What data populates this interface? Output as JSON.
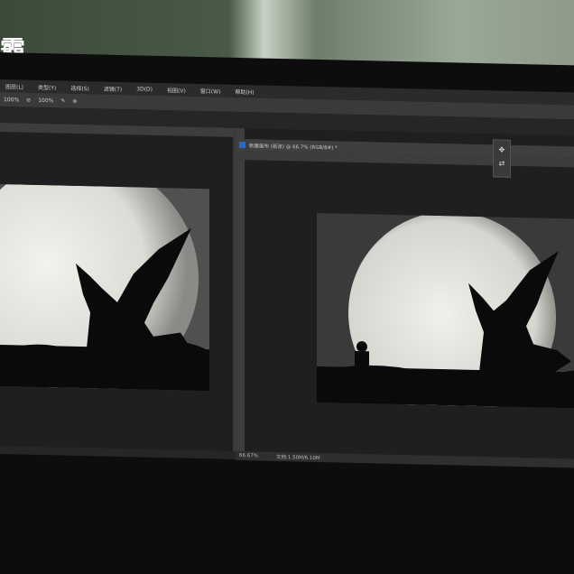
{
  "watermark": {
    "text": "霸"
  },
  "menu": {
    "items": [
      "图层(L)",
      "类型(Y)",
      "选择(S)",
      "滤镜(T)",
      "3D(D)",
      "视图(V)",
      "窗口(W)",
      "帮助(H)"
    ]
  },
  "options": {
    "opacity": "100%",
    "flow": "100%"
  },
  "document": {
    "tab_title": "新建画布 (纸张) @ 66.7% (RGB/8#) *",
    "zoom": "66.67%",
    "doc_size": "文档:1.50M/6.10M"
  },
  "colors": {
    "ui_dark": "#262627",
    "ps_blue": "#1f6ecf",
    "moon": "#e8e8e3"
  }
}
